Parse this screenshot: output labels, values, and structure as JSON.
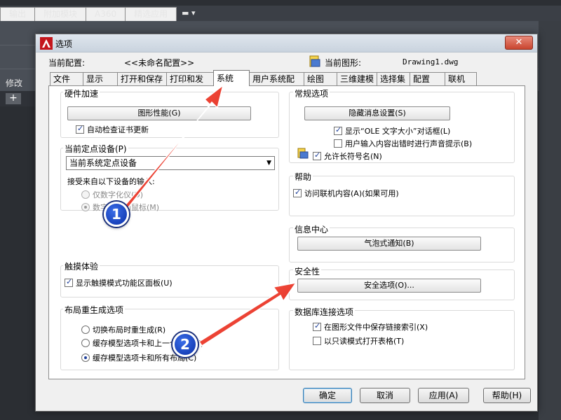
{
  "background": {
    "menu_tabs": [
      "输出",
      "附加模块",
      "A360",
      "精选应用"
    ],
    "left_items": [
      "修改"
    ],
    "tab_add": "+"
  },
  "dialog": {
    "title": "选项",
    "current_profile_label": "当前配置:",
    "current_profile_value": "<<未命名配置>>",
    "current_drawing_label": "当前图形:",
    "current_drawing_value": "Drawing1.dwg",
    "tabs": [
      "文件",
      "显示",
      "打开和保存",
      "打印和发布",
      "系统",
      "用户系统配置",
      "绘图",
      "三维建模",
      "选择集",
      "配置",
      "联机"
    ],
    "active_tab": "系统",
    "hardware": {
      "title": "硬件加速",
      "button": "图形性能(G)",
      "check_updates": "自动检查证书更新"
    },
    "pointing": {
      "title": "当前定点设备(P)",
      "device": "当前系统定点设备",
      "accept_label": "接受来自以下设备的输入:",
      "opt_digitizer": "仅数字化仪(D)",
      "opt_mouse": "数字化仪和鼠标(M)"
    },
    "touch": {
      "title": "触摸体验",
      "show_panel": "显示触摸模式功能区面板(U)"
    },
    "layout_regen": {
      "title": "布局重生成选项",
      "opt1": "切换布局时重生成(R)",
      "opt2": "缓存模型选项卡和上一个布局(Y)",
      "opt3": "缓存模型选项卡和所有布局(C)"
    },
    "general": {
      "title": "常规选项",
      "button": "隐藏消息设置(S)",
      "ole": "显示“OLE 文字大小”对话框(L)",
      "beep": "用户输入内容出错时进行声音提示(B)",
      "long_names": "允许长符号名(N)"
    },
    "help": {
      "title": "帮助",
      "online": "访问联机内容(A)(如果可用)"
    },
    "info_center": {
      "title": "信息中心",
      "button": "气泡式通知(B)"
    },
    "security": {
      "title": "安全性",
      "button": "安全选项(O)..."
    },
    "db_connect": {
      "title": "数据库连接选项",
      "store_index": "在图形文件中保存链接索引(X)",
      "readonly": "以只读模式打开表格(T)"
    },
    "buttons": {
      "ok": "确定",
      "cancel": "取消",
      "apply": "应用(A)",
      "help": "帮助(H)"
    }
  },
  "annotations": {
    "badge1": "1",
    "badge2": "2",
    "arrow_color": "#e8231e"
  }
}
